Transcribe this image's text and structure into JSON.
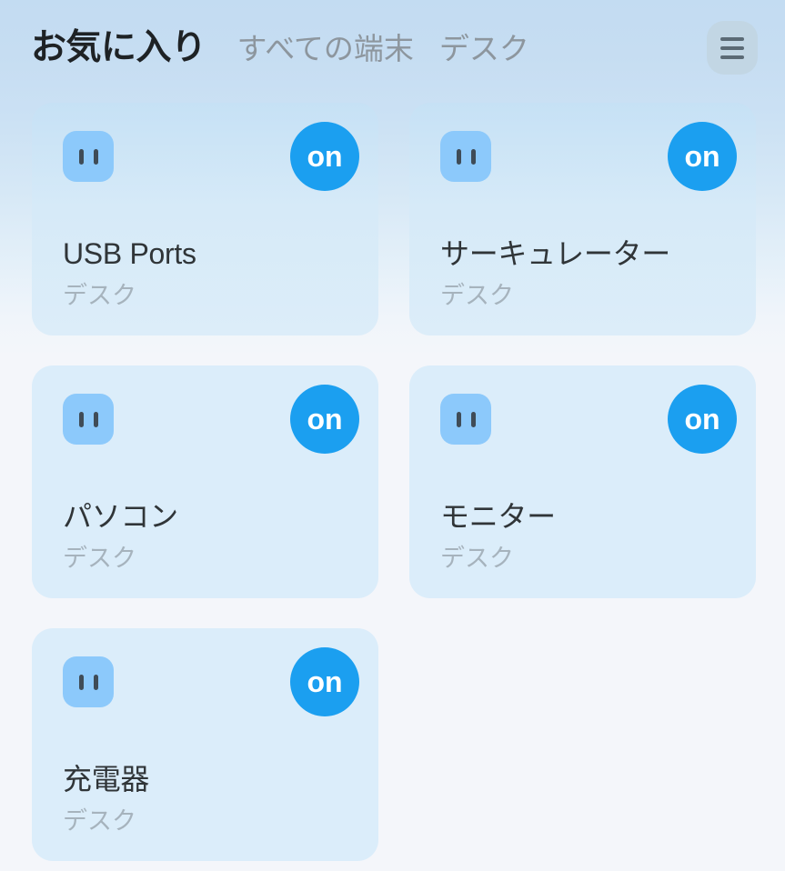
{
  "header": {
    "tabs": [
      {
        "label": "お気に入り",
        "active": true,
        "name": "tab-favorites"
      },
      {
        "label": "すべての端末",
        "active": false,
        "name": "tab-all-devices"
      },
      {
        "label": "デスク",
        "active": false,
        "name": "tab-desk"
      }
    ],
    "menu_button": {
      "icon": "hamburger-menu-icon",
      "aria_label": "メニュー"
    }
  },
  "colors": {
    "accent_on": "#1b9ff0",
    "icon_tile": "#8cc9fb",
    "card_bg": "#dbedfa",
    "page_bg_top": "#c3dcf2",
    "page_bg_bottom": "#f4f6fa",
    "title_text": "#303538",
    "subtitle_text": "#a6b3bd",
    "tab_inactive_text": "#8d969e"
  },
  "devices": [
    {
      "title": "USB Ports",
      "room": "デスク",
      "state_label": "on",
      "state": "on",
      "icon": "power-outlet-icon"
    },
    {
      "title": "サーキュレーター",
      "room": "デスク",
      "state_label": "on",
      "state": "on",
      "icon": "power-outlet-icon"
    },
    {
      "title": "パソコン",
      "room": "デスク",
      "state_label": "on",
      "state": "on",
      "icon": "power-outlet-icon"
    },
    {
      "title": "モニター",
      "room": "デスク",
      "state_label": "on",
      "state": "on",
      "icon": "power-outlet-icon"
    },
    {
      "title": "充電器",
      "room": "デスク",
      "state_label": "on",
      "state": "on",
      "icon": "power-outlet-icon"
    }
  ]
}
